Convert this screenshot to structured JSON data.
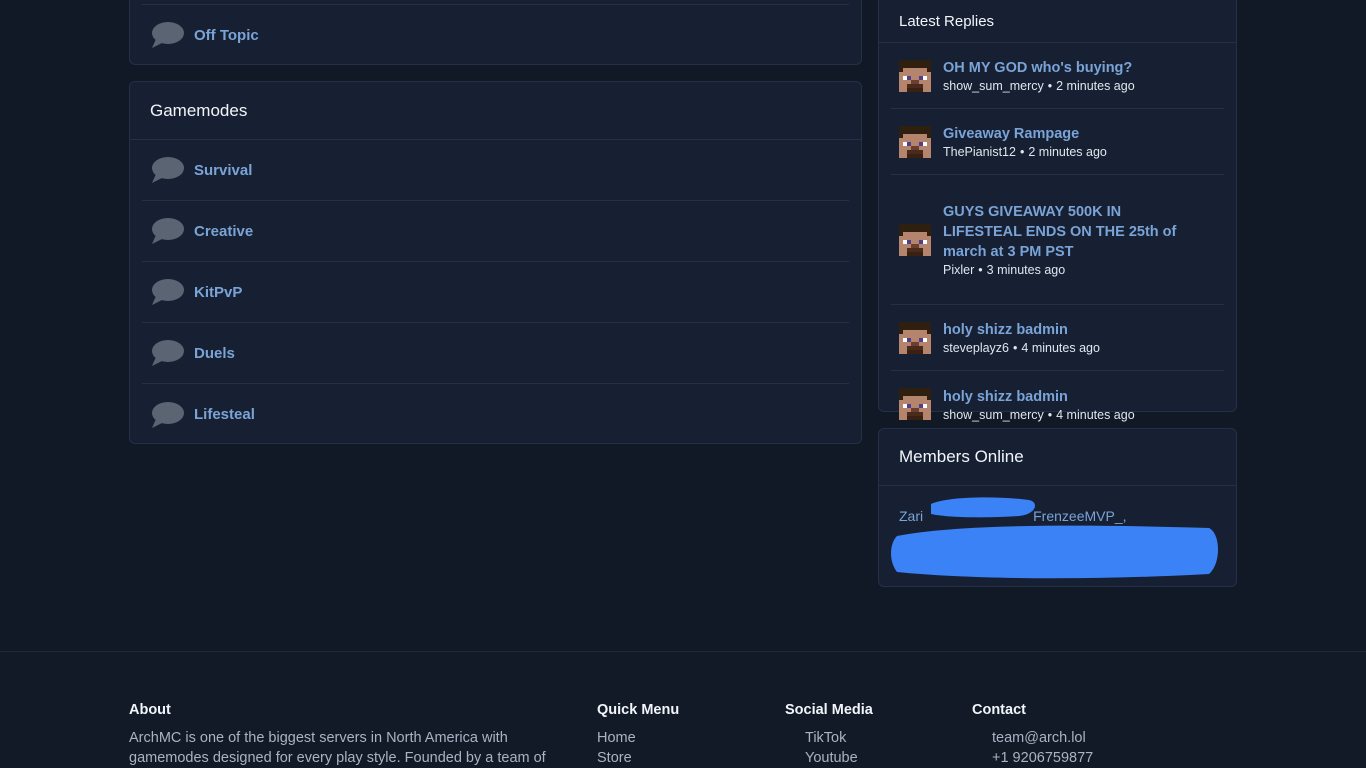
{
  "forums_top": {
    "items": [
      {
        "label": "Off Topic"
      }
    ]
  },
  "gamemodes": {
    "title": "Gamemodes",
    "items": [
      {
        "label": "Survival"
      },
      {
        "label": "Creative"
      },
      {
        "label": "KitPvP"
      },
      {
        "label": "Duels"
      },
      {
        "label": "Lifesteal"
      }
    ]
  },
  "latest_replies": {
    "title": "Latest Replies",
    "items": [
      {
        "title": "OH MY GOD who's buying?",
        "user": "show_sum_mercy",
        "time": "2 minutes ago"
      },
      {
        "title": "Giveaway Rampage",
        "user": "ThePianist12",
        "time": "2 minutes ago"
      },
      {
        "title": "GUYS GIVEAWAY 500K IN LIFESTEAL ENDS ON THE 25th of march at 3 PM PST",
        "user": "Pixler",
        "time": "3 minutes ago"
      },
      {
        "title": "holy shizz badmin",
        "user": "steveplayz6",
        "time": "4 minutes ago"
      },
      {
        "title": "holy shizz badmin",
        "user": "show_sum_mercy",
        "time": "4 minutes ago"
      }
    ],
    "separator": "•"
  },
  "members_online": {
    "title": "Members Online",
    "members": [
      "Zari",
      "FrenzeeMVP_,"
    ],
    "redaction_color": "#3b82f6"
  },
  "footer": {
    "about": {
      "heading": "About",
      "text": "ArchMC is one of the biggest servers in North America with gamemodes designed for every play style. Founded by a team of"
    },
    "quick_menu": {
      "heading": "Quick Menu",
      "links": [
        "Home",
        "Store"
      ]
    },
    "social_media": {
      "heading": "Social Media",
      "links": [
        "TikTok",
        "Youtube"
      ]
    },
    "contact": {
      "heading": "Contact",
      "links": [
        "team@arch.lol",
        "+1 9206759877"
      ]
    }
  },
  "colors": {
    "background": "#111927",
    "card": "#172033",
    "border": "#243047",
    "link": "#7aa3d6"
  },
  "icons": {
    "forum": "chat-bubble-icon",
    "avatar": "steve-avatar-icon"
  }
}
